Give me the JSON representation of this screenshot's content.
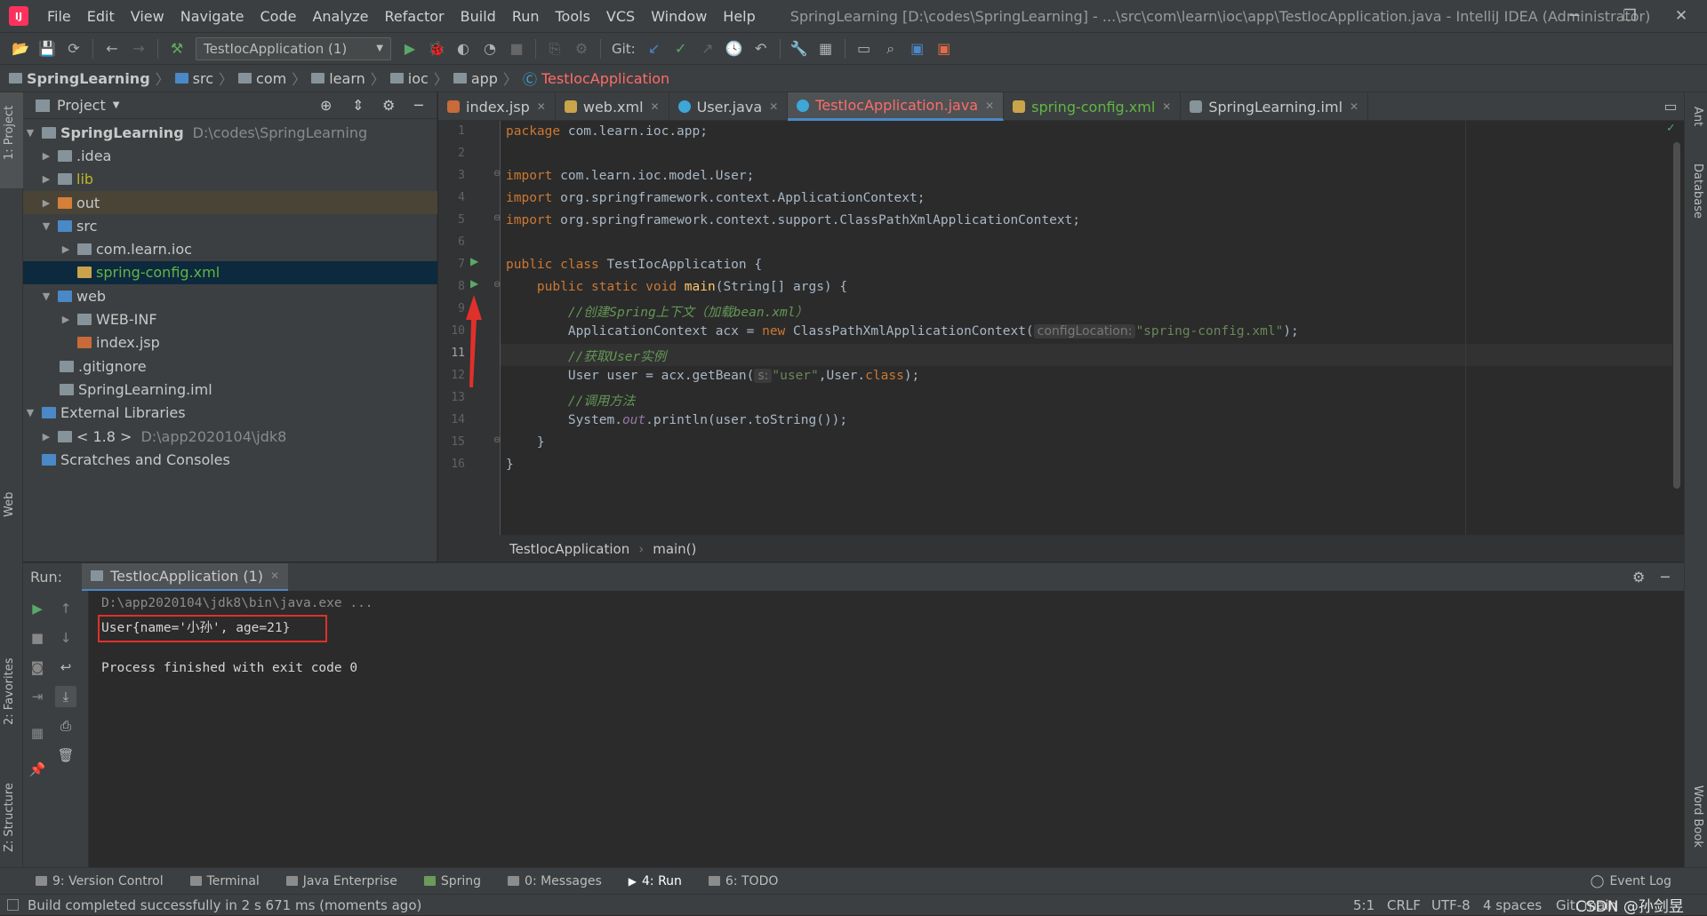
{
  "app": {
    "title": "SpringLearning [D:\\codes\\SpringLearning] - ...\\src\\com\\learn\\ioc\\app\\TestIocApplication.java - IntelliJ IDEA (Administrator)"
  },
  "menu": [
    "File",
    "Edit",
    "View",
    "Navigate",
    "Code",
    "Analyze",
    "Refactor",
    "Build",
    "Run",
    "Tools",
    "VCS",
    "Window",
    "Help"
  ],
  "toolbar": {
    "run_config": "TestIocApplication (1)",
    "git_label": "Git:"
  },
  "breadcrumb": [
    "SpringLearning",
    "src",
    "com",
    "learn",
    "ioc",
    "app",
    "TestIocApplication"
  ],
  "project": {
    "header": "Project",
    "tree": [
      {
        "label": "SpringLearning",
        "hint": "D:\\codes\\SpringLearning"
      },
      {
        "label": ".idea"
      },
      {
        "label": "lib"
      },
      {
        "label": "out"
      },
      {
        "label": "src"
      },
      {
        "label": "com.learn.ioc"
      },
      {
        "label": "spring-config.xml"
      },
      {
        "label": "web"
      },
      {
        "label": "WEB-INF"
      },
      {
        "label": "index.jsp"
      },
      {
        "label": ".gitignore"
      },
      {
        "label": "SpringLearning.iml"
      },
      {
        "label": "External Libraries"
      },
      {
        "label": "< 1.8 >",
        "hint": "D:\\app2020104\\jdk8"
      },
      {
        "label": "Scratches and Consoles"
      }
    ]
  },
  "tabs": [
    "index.jsp",
    "web.xml",
    "User.java",
    "TestIocApplication.java",
    "spring-config.xml",
    "SpringLearning.iml"
  ],
  "code": {
    "l1a": "package",
    "l1b": " com.learn.ioc.app;",
    "l3a": "import",
    "l3b": " com.learn.ioc.model.User;",
    "l4a": "import",
    "l4b": " org.springframework.context.ApplicationContext;",
    "l5a": "import",
    "l5b": " org.springframework.context.support.ClassPathXmlApplicationContext;",
    "l7a": "public class",
    "l7b": " TestIocApplication {",
    "l8a": "    public static void ",
    "l8b": "main",
    "l8c": "(String[] args) {",
    "l9": "        //创建Spring上下文（加载bean.xml）",
    "l10a": "        ApplicationContext acx = ",
    "l10b": "new",
    "l10c": " ClassPathXmlApplicationContext(",
    "l10h": "configLocation:",
    "l10d": "\"spring-config.xml\"",
    "l10e": ");",
    "l11": "        //获取User实例",
    "l12a": "        User user = acx.getBean(",
    "l12h": "s:",
    "l12b": "\"user\"",
    "l12c": ",User.",
    "l12d": "class",
    "l12e": ");",
    "l13": "        //调用方法",
    "l14a": "        System.",
    "l14b": "out",
    "l14c": ".println(user.toString());",
    "l15": "    }",
    "l16": "}"
  },
  "line_numbers": [
    "1",
    "2",
    "3",
    "4",
    "5",
    "6",
    "7",
    "8",
    "9",
    "10",
    "11",
    "12",
    "13",
    "14",
    "15",
    "16"
  ],
  "editor_footer": {
    "cls": "TestIocApplication",
    "method": "main()"
  },
  "run": {
    "label": "Run:",
    "tab": "TestIocApplication (1)"
  },
  "console": {
    "cmd": "D:\\app2020104\\jdk8\\bin\\java.exe ...",
    "out": "User{name='小孙', age=21}",
    "exit": "Process finished with exit code 0"
  },
  "bottom_tabs": [
    "9: Version Control",
    "Terminal",
    "Java Enterprise",
    "Spring",
    "0: Messages",
    "4: Run",
    "6: TODO"
  ],
  "event_log": "Event Log",
  "status": {
    "message": "Build completed successfully in 2 s 671 ms (moments ago)",
    "pos": "5:1",
    "crlf": "CRLF",
    "enc": "UTF-8",
    "indent": "4 spaces",
    "git": "Git: main",
    "watermark": "CSDN @孙剑昱"
  },
  "strips": {
    "project": "1: Project",
    "web": "Web",
    "favorites": "2: Favorites",
    "structure": "Z: Structure",
    "ant": "Ant",
    "database": "Database",
    "wordbook": "Word Book"
  },
  "colors": {
    "accent": "#4a88c7",
    "highlight_box": "#e0302a",
    "active_tab_text": "#ff6b68"
  }
}
